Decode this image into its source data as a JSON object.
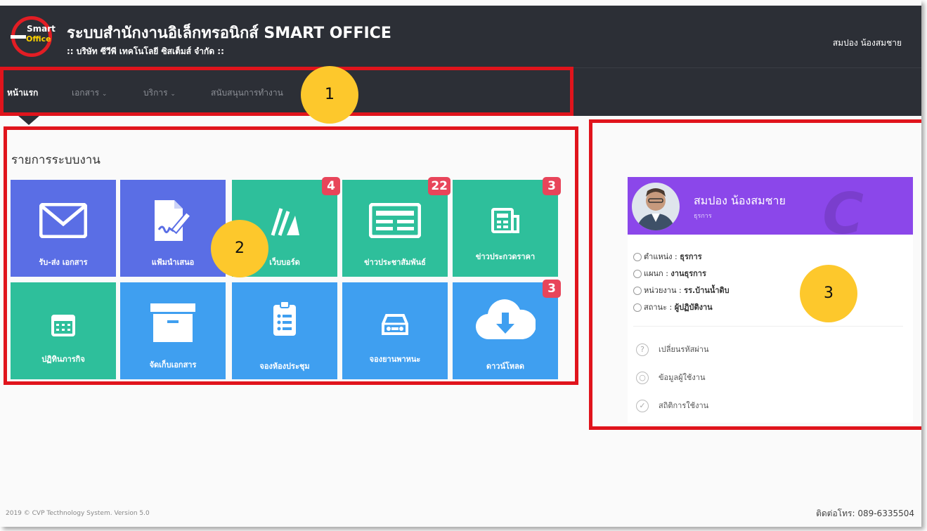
{
  "header": {
    "logo_line1": "Smart",
    "logo_line2": "Office",
    "title": "ระบบสำนักงานอิเล็กทรอนิกส์ SMART OFFICE",
    "subtitle": ":: บริษัท ซีวีพี เทคโนโลยี ซิสเต็มส์ จำกัด ::",
    "user_name": "สมปอง น้องสมชาย"
  },
  "nav": {
    "items": [
      {
        "label": "หน้าแรก"
      },
      {
        "label": "เอกสาร"
      },
      {
        "label": "บริการ"
      },
      {
        "label": "สนับสนุนการทำงาน"
      }
    ]
  },
  "markers": [
    "1",
    "2",
    "3"
  ],
  "main": {
    "section_title": "รายการระบบงาน",
    "tiles": [
      {
        "label": "รับ-ส่ง เอกสาร",
        "icon": "envelope-icon",
        "color": "#5a6ee5",
        "badge": ""
      },
      {
        "label": "แฟ้มนำเสนอ",
        "icon": "document-sign-icon",
        "color": "#5a6ee5",
        "badge": ""
      },
      {
        "label": "เว็บบอร์ด",
        "icon": "chat-icon",
        "color": "#2ebf9b",
        "badge": "4"
      },
      {
        "label": "ข่าวประชาสัมพันธ์",
        "icon": "newspaper-icon",
        "color": "#2ebf9b",
        "badge": "22"
      },
      {
        "label": "ข่าวประกวดราคา",
        "icon": "news-icon",
        "color": "#2ebf9b",
        "badge": "3"
      },
      {
        "label": "ปฏิทินภารกิจ",
        "icon": "calendar-icon",
        "color": "#2ebf9b",
        "badge": ""
      },
      {
        "label": "จัดเก็บเอกสาร",
        "icon": "archive-icon",
        "color": "#3f9ff0",
        "badge": ""
      },
      {
        "label": "จองห้องประชุม",
        "icon": "clipboard-icon",
        "color": "#3f9ff0",
        "badge": ""
      },
      {
        "label": "จองยานพาหนะ",
        "icon": "car-icon",
        "color": "#3f9ff0",
        "badge": ""
      },
      {
        "label": "ดาวน์โหลด",
        "icon": "cloud-download-icon",
        "color": "#3f9ff0",
        "badge": "3"
      }
    ]
  },
  "profile": {
    "name": "สมปอง น้องสมชาย",
    "role": "ธุรการ",
    "info": [
      {
        "label": "ตำแหน่ง",
        "value": "ธุรการ"
      },
      {
        "label": "แผนก",
        "value": "งานธุรการ"
      },
      {
        "label": "หน่วยงาน",
        "value": "รร.บ้านน้ำดิบ"
      },
      {
        "label": "สถานะ",
        "value": "ผู้ปฏิบัติงาน"
      }
    ],
    "menu": [
      {
        "label": "เปลี่ยนรหัสผ่าน",
        "icon": "question-circle-icon"
      },
      {
        "label": "ข้อมูลผู้ใช้งาน",
        "icon": "user-circle-icon"
      },
      {
        "label": "สถิติการใช้งาน",
        "icon": "chart-icon"
      }
    ]
  },
  "footer": {
    "copyright": "2019 © CVP Tecthnology System. Version 5.0",
    "contact": "ติดต่อโทร: 089-6335504"
  }
}
